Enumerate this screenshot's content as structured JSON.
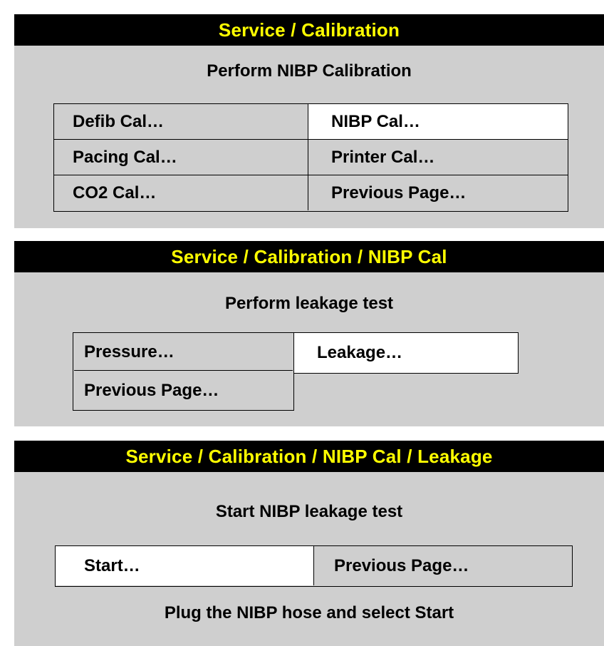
{
  "screen1": {
    "title": "Service / Calibration",
    "prompt": "Perform NIBP Calibration",
    "options": [
      {
        "label": "Defib Cal…",
        "selected": false
      },
      {
        "label": "NIBP Cal…",
        "selected": true
      },
      {
        "label": "Pacing Cal…",
        "selected": false
      },
      {
        "label": "Printer Cal…",
        "selected": false
      },
      {
        "label": "CO2 Cal…",
        "selected": false
      },
      {
        "label": "Previous Page…",
        "selected": false
      }
    ]
  },
  "screen2": {
    "title": "Service / Calibration / NIBP Cal",
    "prompt": "Perform leakage test",
    "options": [
      {
        "label": "Pressure…",
        "selected": false
      },
      {
        "label": "Leakage…",
        "selected": true
      },
      {
        "label": "Previous Page…",
        "selected": false
      }
    ]
  },
  "screen3": {
    "title": "Service / Calibration / NIBP Cal / Leakage",
    "prompt": "Start NIBP leakage test",
    "options": [
      {
        "label": "Start…",
        "selected": true
      },
      {
        "label": "Previous Page…",
        "selected": false
      }
    ],
    "hint": "Plug the NIBP hose and select Start"
  },
  "colors": {
    "title_bg": "#000000",
    "title_fg": "#ffff00",
    "screen_bg": "#cfcfcf",
    "selected_bg": "#ffffff"
  }
}
